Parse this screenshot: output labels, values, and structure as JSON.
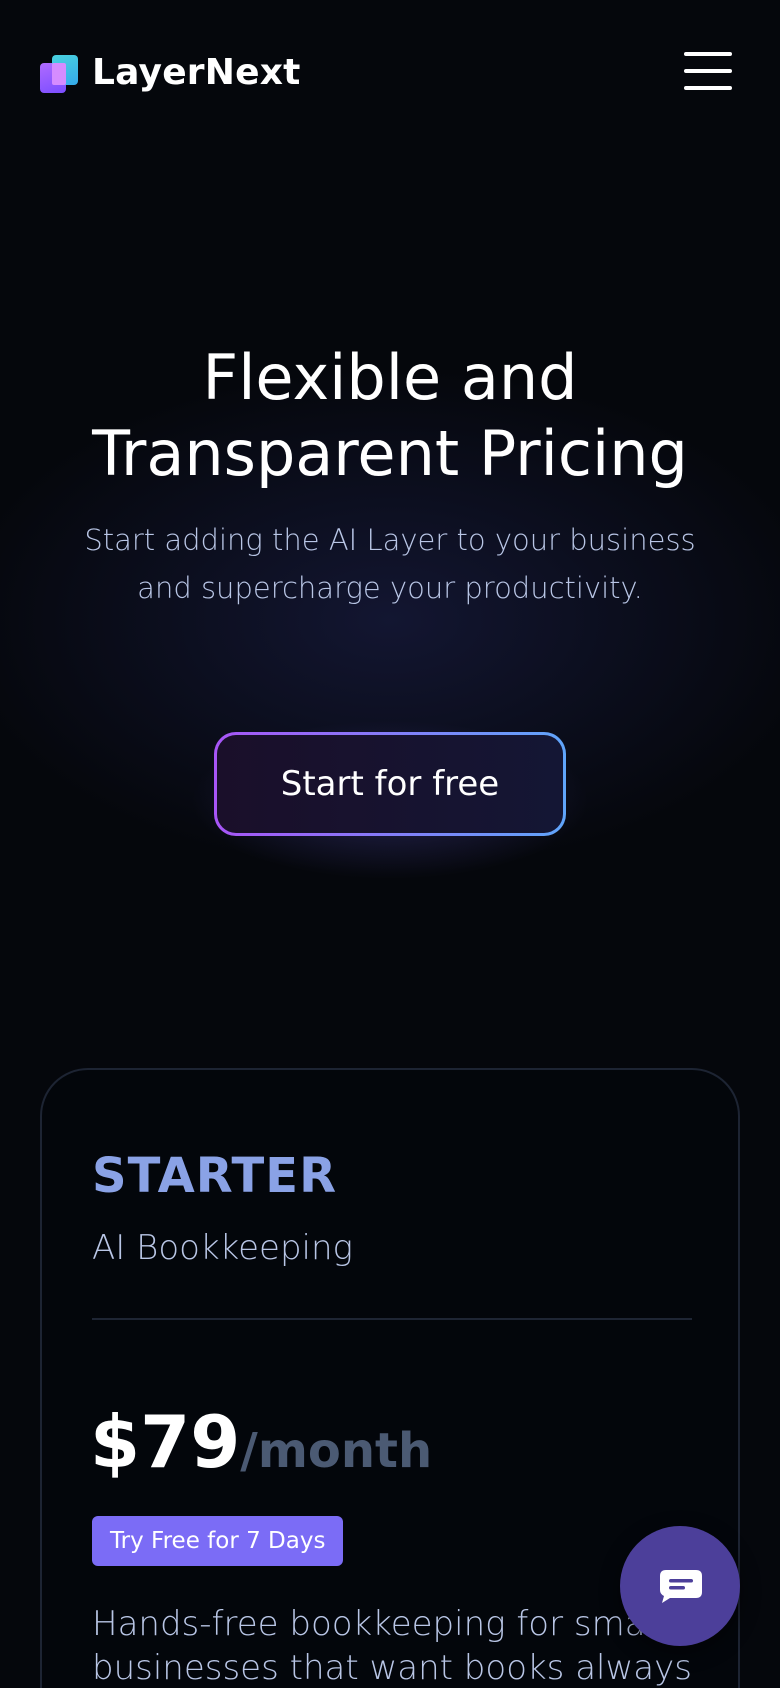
{
  "header": {
    "brand": "LayerNext",
    "menu_icon": "hamburger-menu-icon"
  },
  "hero": {
    "title": "Flexible and Transparent Pricing",
    "subtitle": "Start adding the AI Layer to your business and supercharge your productivity.",
    "cta_label": "Start for free"
  },
  "pricing": {
    "plan_name": "STARTER",
    "plan_subtitle": "AI Bookkeeping",
    "price": "$79",
    "period": "/month",
    "trial_label": "Try Free for 7 Days",
    "description": "Hands-free bookkeeping for small businesses that want books always"
  },
  "chat": {
    "icon": "chat-bubble-icon"
  },
  "colors": {
    "background": "#05070c",
    "plan_accent": "#8aa2e6",
    "badge": "#7b6cf6",
    "cta_gradient_start": "#a855f7",
    "cta_gradient_end": "#60a5fa",
    "chat_button": "#4c3f9a"
  }
}
